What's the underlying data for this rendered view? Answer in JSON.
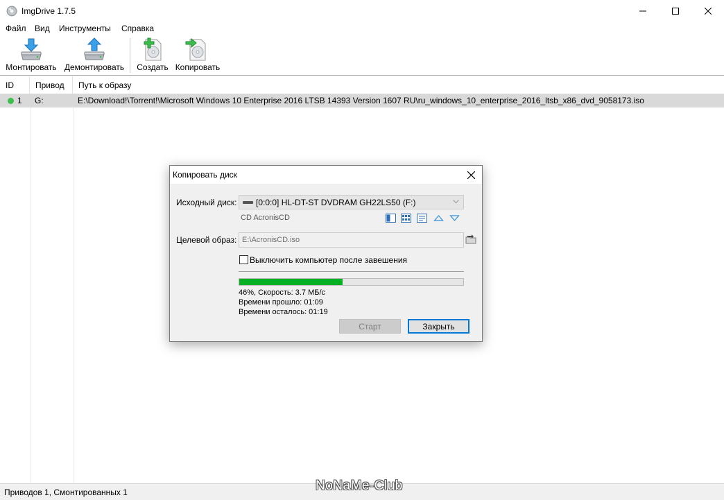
{
  "window": {
    "title": "ImgDrive 1.7.5"
  },
  "menu": [
    "Файл",
    "Вид",
    "Инструменты",
    "Справка"
  ],
  "toolbar": {
    "mount": "Монтировать",
    "unmount": "Демонтировать",
    "create": "Создать",
    "copy": "Копировать"
  },
  "list": {
    "columns": [
      "ID",
      "Привод",
      "Путь к образу"
    ],
    "rows": [
      {
        "id": "1",
        "drive": "G:",
        "path": "E:\\Download!\\Torrent!\\Microsoft Windows 10 Enterprise 2016 LTSB 14393 Version 1607 RU\\ru_windows_10_enterprise_2016_ltsb_x86_dvd_9058173.iso"
      }
    ]
  },
  "status": {
    "text": "Приводов 1, Смонтированных 1"
  },
  "watermark": "NoNaMe-Club",
  "dialog": {
    "title": "Копировать диск",
    "source_label": "Исходный диск:",
    "source_value": "[0:0:0] HL-DT-ST DVDRAM GH22LS50 (F:)",
    "disc_name": "CD AcronisCD",
    "target_label": "Целевой образ:",
    "target_value": "E:\\AcronisCD.iso",
    "shutdown_label": "Выключить компьютер после завешения",
    "shutdown_checked": false,
    "progress_percent": 46,
    "progress_text": "46%, Скорость: 3.7 МБ/с",
    "elapsed": "Времени прошло: 01:09",
    "remaining": "Времени осталось: 01:19",
    "start_button": "Старт",
    "close_button": "Закрыть"
  },
  "colors": {
    "progress": "#06b025",
    "accent": "#0078d7",
    "status_ok": "#3cbe4d"
  }
}
